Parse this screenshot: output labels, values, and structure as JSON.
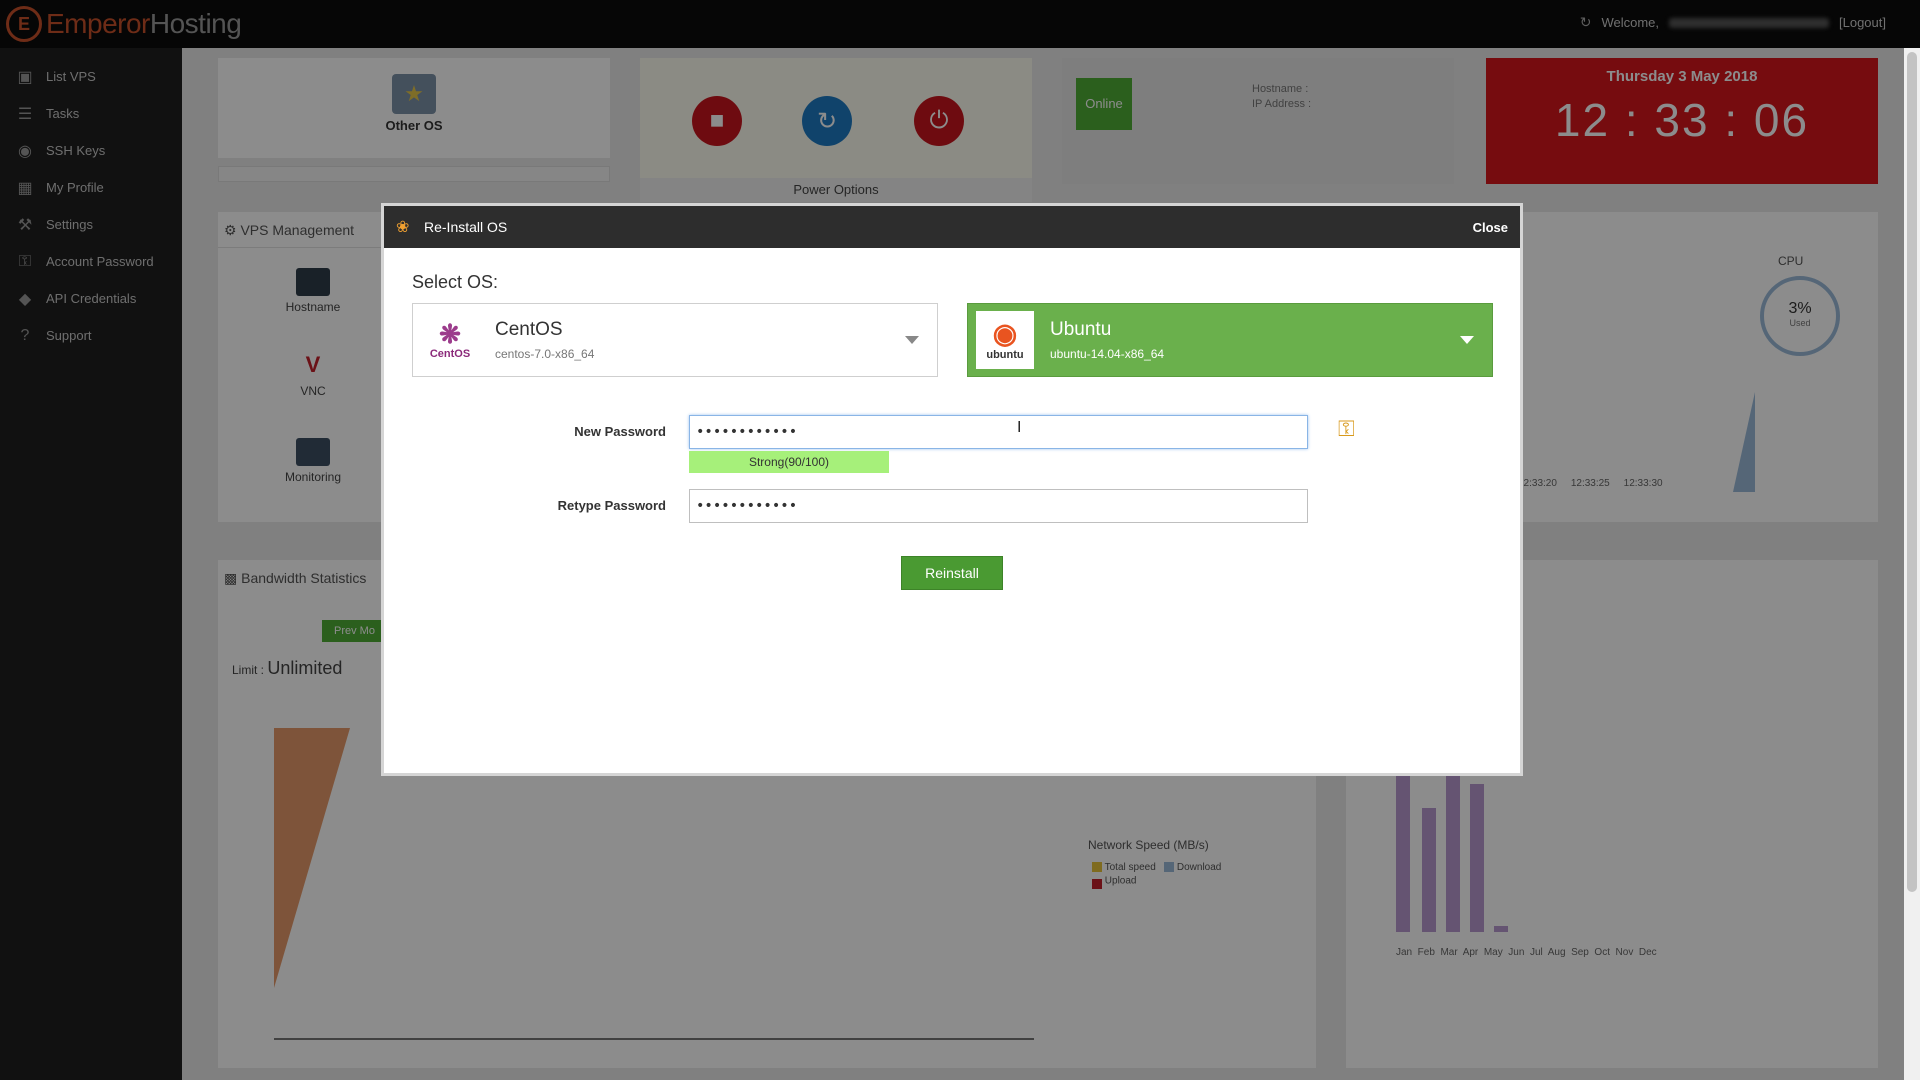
{
  "app": {
    "logo_prefix": "Emperor",
    "logo_suffix": "Hosting",
    "welcome": "Welcome,",
    "logout": "[Logout]"
  },
  "sidebar": {
    "items": [
      {
        "label": "List VPS",
        "icon": "monitor-icon"
      },
      {
        "label": "Tasks",
        "icon": "list-icon"
      },
      {
        "label": "SSH Keys",
        "icon": "lock-icon"
      },
      {
        "label": "My Profile",
        "icon": "id-card-icon"
      },
      {
        "label": "Settings",
        "icon": "wrench-icon"
      },
      {
        "label": "Account Password",
        "icon": "key-icon"
      },
      {
        "label": "API Credentials",
        "icon": "tags-icon"
      },
      {
        "label": "Support",
        "icon": "question-icon"
      }
    ]
  },
  "background": {
    "os_label": "Other OS",
    "power_label": "Power Options",
    "status": "Online",
    "hostname_label": "Hostname :",
    "ip_label": "IP Address :",
    "date": "Thursday 3 May 2018",
    "time": "12 : 33 : 06",
    "mgmt_title": "VPS Management",
    "mgmt_items": [
      "Hostname",
      "VNC",
      "Monitoring"
    ],
    "cpu_label": "CPU",
    "cpu_value": "3%",
    "cpu_used": "Used",
    "cpu_times": "12:33:20     12:33:25     12:33:30",
    "bw_title": "Bandwidth Statistics",
    "prev_button": "Prev Mo",
    "limit_label": "Limit :",
    "limit_value": "Unlimited",
    "network_speed": "Network Speed (MB/s)",
    "legend_total": "Total speed",
    "legend_download": "Download",
    "legend_upload": "Upload",
    "months": "Jan  Feb  Mar  Apr  May  Jun  Jul  Aug  Sep  Oct  Nov  Dec"
  },
  "modal": {
    "title": "Re-Install OS",
    "close": "Close",
    "select_label": "Select OS:",
    "os_options": [
      {
        "name": "CentOS",
        "version": "centos-7.0-x86_64",
        "logo_text": "CentOS"
      },
      {
        "name": "Ubuntu",
        "version": "ubuntu-14.04-x86_64",
        "logo_text": "ubuntu",
        "selected": true
      }
    ],
    "new_password_label": "New Password",
    "new_password_value": "••••••••••••",
    "strength": "Strong(90/100)",
    "retype_password_label": "Retype Password",
    "retype_password_value": "••••••••••••",
    "reinstall_button": "Reinstall"
  },
  "colors": {
    "brand": "#c8502a",
    "ubuntu_green": "#6ab04c",
    "button_green": "#4a9a32",
    "strength_green": "#a6f07a",
    "clock_red": "#d7161d"
  }
}
